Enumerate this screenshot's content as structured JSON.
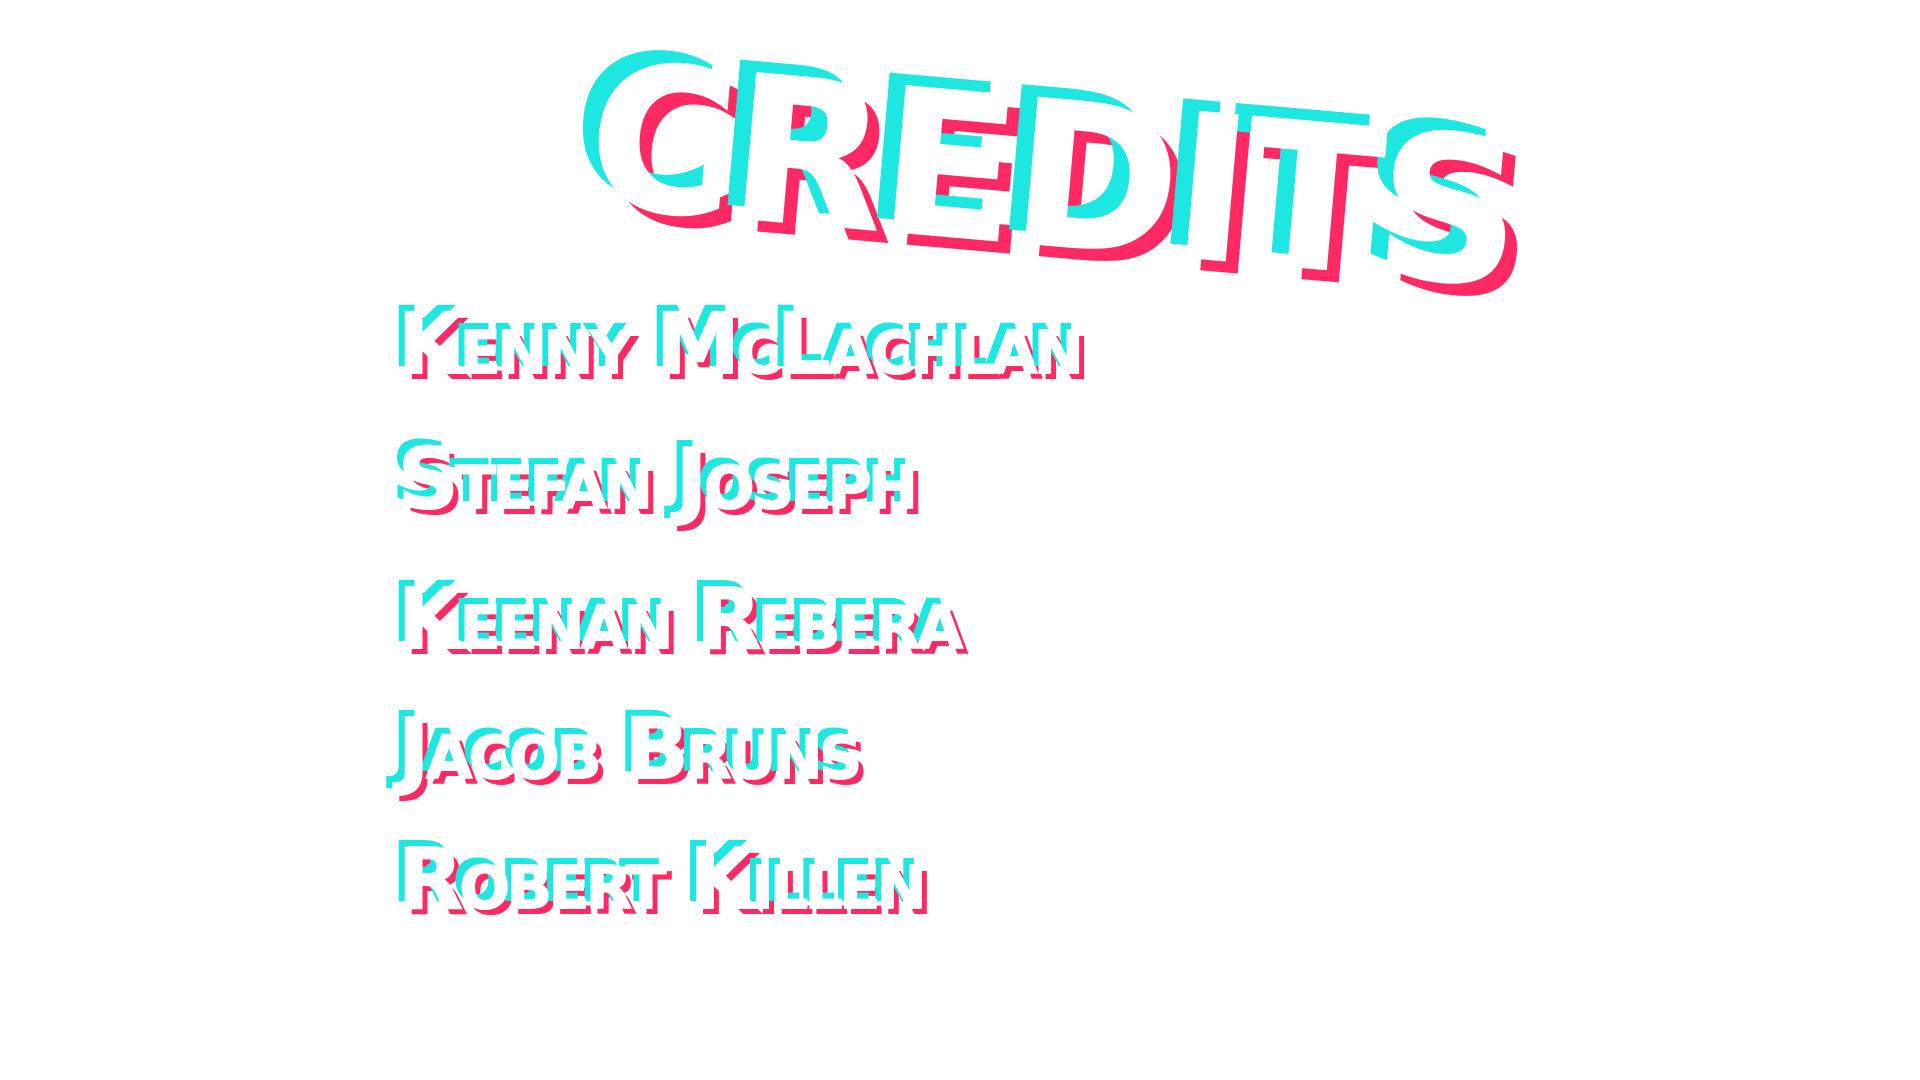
{
  "title": "CREDITS",
  "names": [
    "Kenny McLachlan",
    "Stefan Joseph",
    "Keenan Rebera",
    "Jacob Bruns",
    "Robert Killen"
  ],
  "colors": {
    "background": "#ffffff",
    "text_fill": "#ffffff",
    "cyan_shadow": "#1ee6e0",
    "pink_shadow": "#ff2a63"
  }
}
